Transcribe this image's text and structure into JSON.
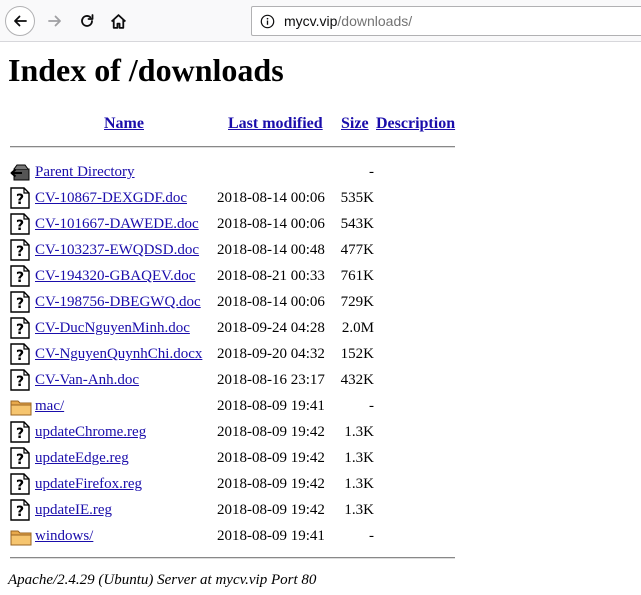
{
  "browser": {
    "url_host": "mycv.vip",
    "url_path": "/downloads/",
    "icons": [
      "back-arrow-icon",
      "forward-arrow-icon",
      "reload-icon",
      "home-icon",
      "info-icon"
    ]
  },
  "page": {
    "title": "Index of /downloads",
    "columns": {
      "name": "Name",
      "last_modified": "Last modified",
      "size": "Size",
      "description": "Description"
    },
    "entries": [
      {
        "name": "Parent Directory",
        "date": "",
        "size": "-",
        "icon": "back-folder-icon"
      },
      {
        "name": "CV-10867-DEXGDF.doc",
        "date": "2018-08-14 00:06",
        "size": "535K",
        "icon": "unknown-file-icon"
      },
      {
        "name": "CV-101667-DAWEDE.doc",
        "date": "2018-08-14 00:06",
        "size": "543K",
        "icon": "unknown-file-icon"
      },
      {
        "name": "CV-103237-EWQDSD.doc",
        "date": "2018-08-14 00:48",
        "size": "477K",
        "icon": "unknown-file-icon"
      },
      {
        "name": "CV-194320-GBAQEV.doc",
        "date": "2018-08-21 00:33",
        "size": "761K",
        "icon": "unknown-file-icon"
      },
      {
        "name": "CV-198756-DBEGWQ.doc",
        "date": "2018-08-14 00:06",
        "size": "729K",
        "icon": "unknown-file-icon"
      },
      {
        "name": "CV-DucNguyenMinh.doc",
        "date": "2018-09-24 04:28",
        "size": "2.0M",
        "icon": "unknown-file-icon"
      },
      {
        "name": "CV-NguyenQuynhChi.docx",
        "date": "2018-09-20 04:32",
        "size": "152K",
        "icon": "unknown-file-icon"
      },
      {
        "name": "CV-Van-Anh.doc",
        "date": "2018-08-16 23:17",
        "size": "432K",
        "icon": "unknown-file-icon"
      },
      {
        "name": "mac/",
        "date": "2018-08-09 19:41",
        "size": "-",
        "icon": "folder-icon"
      },
      {
        "name": "updateChrome.reg",
        "date": "2018-08-09 19:42",
        "size": "1.3K",
        "icon": "unknown-file-icon"
      },
      {
        "name": "updateEdge.reg",
        "date": "2018-08-09 19:42",
        "size": "1.3K",
        "icon": "unknown-file-icon"
      },
      {
        "name": "updateFirefox.reg",
        "date": "2018-08-09 19:42",
        "size": "1.3K",
        "icon": "unknown-file-icon"
      },
      {
        "name": "updateIE.reg",
        "date": "2018-08-09 19:42",
        "size": "1.3K",
        "icon": "unknown-file-icon"
      },
      {
        "name": "windows/",
        "date": "2018-08-09 19:41",
        "size": "-",
        "icon": "folder-icon"
      }
    ],
    "footer": "Apache/2.4.29 (Ubuntu) Server at mycv.vip Port 80"
  }
}
